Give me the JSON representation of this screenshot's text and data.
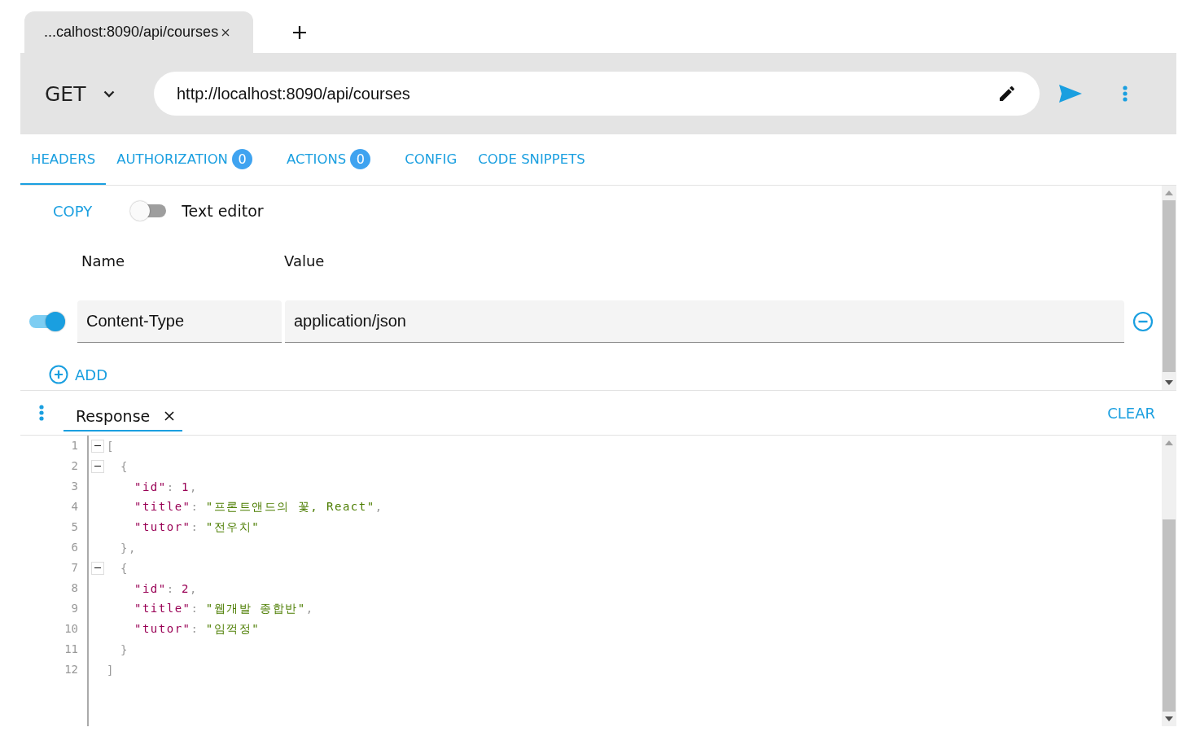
{
  "browser_tabs": [
    {
      "label": "...calhost:8090/api/courses"
    }
  ],
  "request": {
    "method": "GET",
    "url": "http://localhost:8090/api/courses"
  },
  "tabs": [
    {
      "label": "HEADERS",
      "selected": true
    },
    {
      "label": "AUTHORIZATION",
      "selected": false,
      "badge": "0"
    },
    {
      "label": "ACTIONS",
      "selected": false,
      "badge": "0"
    },
    {
      "label": "CONFIG",
      "selected": false
    },
    {
      "label": "CODE SNIPPETS",
      "selected": false
    }
  ],
  "headers": {
    "copy_label": "COPY",
    "text_editor": {
      "label": "Text editor",
      "on": false
    },
    "columns": [
      "Name",
      "Value"
    ],
    "rows": [
      {
        "enabled": true,
        "name": "Content-Type",
        "value": "application/json"
      }
    ],
    "add_label": "ADD"
  },
  "response": {
    "tabs": [
      {
        "label": "Response",
        "selected": true
      }
    ],
    "clear_label": "CLEAR",
    "lines": [
      {
        "number": "1",
        "fold": true,
        "tokens": [
          {
            "kind": "punct",
            "text": "["
          }
        ],
        "children": [
          {
            "number": "2",
            "fold": true,
            "tokens": [
              {
                "kind": "punct",
                "text": "{"
              }
            ],
            "children": [
              {
                "number": "3",
                "fold": false,
                "tokens": [
                  {
                    "kind": "key",
                    "text": "\"id\""
                  },
                  {
                    "kind": "punct",
                    "text": ":"
                  },
                  {
                    "kind": "number",
                    "text": "1"
                  },
                  {
                    "kind": "punct",
                    "text": ","
                  }
                ]
              },
              {
                "number": "4",
                "fold": false,
                "tokens": [
                  {
                    "kind": "key",
                    "text": "\"title\""
                  },
                  {
                    "kind": "punct",
                    "text": ":"
                  },
                  {
                    "kind": "string",
                    "text": "\"프론트앤드의 꽃, React\""
                  },
                  {
                    "kind": "punct",
                    "text": ","
                  }
                ]
              },
              {
                "number": "5",
                "fold": false,
                "tokens": [
                  {
                    "kind": "key",
                    "text": "\"tutor\""
                  },
                  {
                    "kind": "punct",
                    "text": ":"
                  },
                  {
                    "kind": "string",
                    "text": "\"전우치\""
                  }
                ]
              }
            ]
          },
          {
            "number": "6",
            "fold": false,
            "tokens": [
              {
                "kind": "punct",
                "text": "},"
              }
            ]
          },
          {
            "number": "7",
            "fold": true,
            "tokens": [
              {
                "kind": "punct",
                "text": "{"
              }
            ],
            "children": [
              {
                "number": "8",
                "fold": false,
                "tokens": [
                  {
                    "kind": "key",
                    "text": "\"id\""
                  },
                  {
                    "kind": "punct",
                    "text": ":"
                  },
                  {
                    "kind": "number",
                    "text": "2"
                  },
                  {
                    "kind": "punct",
                    "text": ","
                  }
                ]
              },
              {
                "number": "9",
                "fold": false,
                "tokens": [
                  {
                    "kind": "key",
                    "text": "\"title\""
                  },
                  {
                    "kind": "punct",
                    "text": ":"
                  },
                  {
                    "kind": "string",
                    "text": "\"웹개발 종합반\""
                  },
                  {
                    "kind": "punct",
                    "text": ","
                  }
                ]
              },
              {
                "number": "10",
                "fold": false,
                "tokens": [
                  {
                    "kind": "key",
                    "text": "\"tutor\""
                  },
                  {
                    "kind": "punct",
                    "text": ":"
                  },
                  {
                    "kind": "string",
                    "text": "\"임꺽정\""
                  }
                ]
              }
            ]
          },
          {
            "number": "11",
            "fold": false,
            "tokens": [
              {
                "kind": "punct",
                "text": "}"
              }
            ]
          }
        ]
      },
      {
        "number": "12",
        "fold": false,
        "tokens": [
          {
            "kind": "punct",
            "text": "]"
          }
        ]
      }
    ]
  }
}
